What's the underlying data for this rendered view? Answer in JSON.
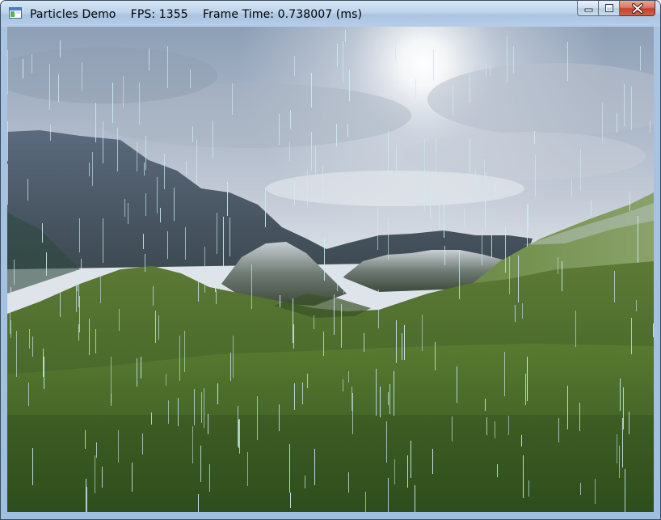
{
  "window": {
    "app_name": "Particles Demo",
    "fps_label": "FPS: 1355",
    "frame_time_label": "Frame Time: 0.738007 (ms)"
  },
  "caption_buttons": {
    "minimize": "minimize-icon",
    "maximize": "maximize-icon",
    "close": "close-icon"
  },
  "colors": {
    "rain": "#c9ecf0",
    "close_button": "#c2432c"
  }
}
